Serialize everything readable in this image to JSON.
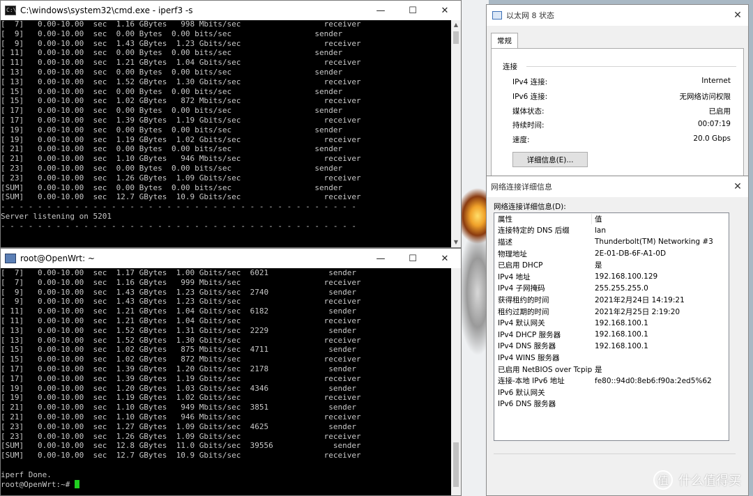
{
  "cmd_window": {
    "title": "C:\\windows\\system32\\cmd.exe - iperf3  -s",
    "icon": "cmd-icon",
    "lines": [
      "[  7]   0.00-10.00  sec  1.16 GBytes   998 Mbits/sec                  receiver",
      "[  9]   0.00-10.00  sec  0.00 Bytes  0.00 bits/sec                  sender",
      "[  9]   0.00-10.00  sec  1.43 GBytes  1.23 Gbits/sec                  receiver",
      "[ 11]   0.00-10.00  sec  0.00 Bytes  0.00 bits/sec                  sender",
      "[ 11]   0.00-10.00  sec  1.21 GBytes  1.04 Gbits/sec                  receiver",
      "[ 13]   0.00-10.00  sec  0.00 Bytes  0.00 bits/sec                  sender",
      "[ 13]   0.00-10.00  sec  1.52 GBytes  1.30 Gbits/sec                  receiver",
      "[ 15]   0.00-10.00  sec  0.00 Bytes  0.00 bits/sec                  sender",
      "[ 15]   0.00-10.00  sec  1.02 GBytes   872 Mbits/sec                  receiver",
      "[ 17]   0.00-10.00  sec  0.00 Bytes  0.00 bits/sec                  sender",
      "[ 17]   0.00-10.00  sec  1.39 GBytes  1.19 Gbits/sec                  receiver",
      "[ 19]   0.00-10.00  sec  0.00 Bytes  0.00 bits/sec                  sender",
      "[ 19]   0.00-10.00  sec  1.19 GBytes  1.02 Gbits/sec                  receiver",
      "[ 21]   0.00-10.00  sec  0.00 Bytes  0.00 bits/sec                  sender",
      "[ 21]   0.00-10.00  sec  1.10 GBytes   946 Mbits/sec                  receiver",
      "[ 23]   0.00-10.00  sec  0.00 Bytes  0.00 bits/sec                  sender",
      "[ 23]   0.00-10.00  sec  1.26 GBytes  1.09 Gbits/sec                  receiver",
      "[SUM]   0.00-10.00  sec  0.00 Bytes  0.00 bits/sec                  sender",
      "[SUM]   0.00-10.00  sec  12.7 GBytes  10.9 Gbits/sec                  receiver",
      "- - - - - - - - - - - - - - - - - - - - - - - - - - - - - - - - - - - - - - -",
      "Server listening on 5201",
      "- - - - - - - - - - - - - - - - - - - - - - - - - - - - - - - - - - - - - - -"
    ]
  },
  "putty_window": {
    "title": "root@OpenWrt: ~",
    "icon": "putty-icon",
    "lines": [
      "[  7]   0.00-10.00  sec  1.17 GBytes  1.00 Gbits/sec  6021             sender",
      "[  7]   0.00-10.00  sec  1.16 GBytes   999 Mbits/sec                  receiver",
      "[  9]   0.00-10.00  sec  1.43 GBytes  1.23 Gbits/sec  2740             sender",
      "[  9]   0.00-10.00  sec  1.43 GBytes  1.23 Gbits/sec                  receiver",
      "[ 11]   0.00-10.00  sec  1.21 GBytes  1.04 Gbits/sec  6182             sender",
      "[ 11]   0.00-10.00  sec  1.21 GBytes  1.04 Gbits/sec                  receiver",
      "[ 13]   0.00-10.00  sec  1.52 GBytes  1.31 Gbits/sec  2229             sender",
      "[ 13]   0.00-10.00  sec  1.52 GBytes  1.30 Gbits/sec                  receiver",
      "[ 15]   0.00-10.00  sec  1.02 GBytes   875 Mbits/sec  4711             sender",
      "[ 15]   0.00-10.00  sec  1.02 GBytes   872 Mbits/sec                  receiver",
      "[ 17]   0.00-10.00  sec  1.39 GBytes  1.20 Gbits/sec  2178             sender",
      "[ 17]   0.00-10.00  sec  1.39 GBytes  1.19 Gbits/sec                  receiver",
      "[ 19]   0.00-10.00  sec  1.20 GBytes  1.03 Gbits/sec  4346             sender",
      "[ 19]   0.00-10.00  sec  1.19 GBytes  1.02 Gbits/sec                  receiver",
      "[ 21]   0.00-10.00  sec  1.10 GBytes   949 Mbits/sec  3851             sender",
      "[ 21]   0.00-10.00  sec  1.10 GBytes   946 Mbits/sec                  receiver",
      "[ 23]   0.00-10.00  sec  1.27 GBytes  1.09 Gbits/sec  4625             sender",
      "[ 23]   0.00-10.00  sec  1.26 GBytes  1.09 Gbits/sec                  receiver",
      "[SUM]   0.00-10.00  sec  12.8 GBytes  11.0 Gbits/sec  39556             sender",
      "[SUM]   0.00-10.00  sec  12.7 GBytes  10.9 Gbits/sec                  receiver",
      "",
      "iperf Done."
    ],
    "prompt": "root@OpenWrt:~# "
  },
  "status_dialog": {
    "title": "以太网 8 状态",
    "tab": "常规",
    "group_label": "连接",
    "rows": [
      {
        "label": "IPv4 连接:",
        "value": "Internet"
      },
      {
        "label": "IPv6 连接:",
        "value": "无网络访问权限"
      },
      {
        "label": "媒体状态:",
        "value": "已启用"
      },
      {
        "label": "持续时间:",
        "value": "00:07:19"
      },
      {
        "label": "速度:",
        "value": "20.0 Gbps"
      }
    ],
    "details_button": "详细信息(E)...",
    "close_glyph": "✕"
  },
  "details_dialog": {
    "title": "网络连接详细信息",
    "caption": "网络连接详细信息(D):",
    "header": {
      "key": "属性",
      "value": "值"
    },
    "rows": [
      {
        "key": "连接特定的 DNS 后缀",
        "value": "lan"
      },
      {
        "key": "描述",
        "value": "Thunderbolt(TM) Networking #3"
      },
      {
        "key": "物理地址",
        "value": "2E-01-DB-6F-A1-0D"
      },
      {
        "key": "已启用 DHCP",
        "value": "是"
      },
      {
        "key": "IPv4 地址",
        "value": "192.168.100.129"
      },
      {
        "key": "IPv4 子网掩码",
        "value": "255.255.255.0"
      },
      {
        "key": "获得租约的时间",
        "value": "2021年2月24日 14:19:21"
      },
      {
        "key": "租约过期的时间",
        "value": "2021年2月25日 2:19:20"
      },
      {
        "key": "IPv4 默认网关",
        "value": "192.168.100.1"
      },
      {
        "key": "IPv4 DHCP 服务器",
        "value": "192.168.100.1"
      },
      {
        "key": "IPv4 DNS 服务器",
        "value": "192.168.100.1"
      },
      {
        "key": "IPv4 WINS 服务器",
        "value": ""
      },
      {
        "key": "已启用 NetBIOS over Tcpip",
        "value": "是"
      },
      {
        "key": "连接-本地 IPv6 地址",
        "value": "fe80::94d0:8eb6:f90a:2ed5%62"
      },
      {
        "key": "IPv6 默认网关",
        "value": ""
      },
      {
        "key": "IPv6 DNS 服务器",
        "value": ""
      }
    ],
    "close_glyph": "✕"
  },
  "window_controls": {
    "minimize": "—",
    "maximize": "☐",
    "close": "✕"
  },
  "watermark": {
    "badge": "值",
    "text": "什么值得买"
  }
}
